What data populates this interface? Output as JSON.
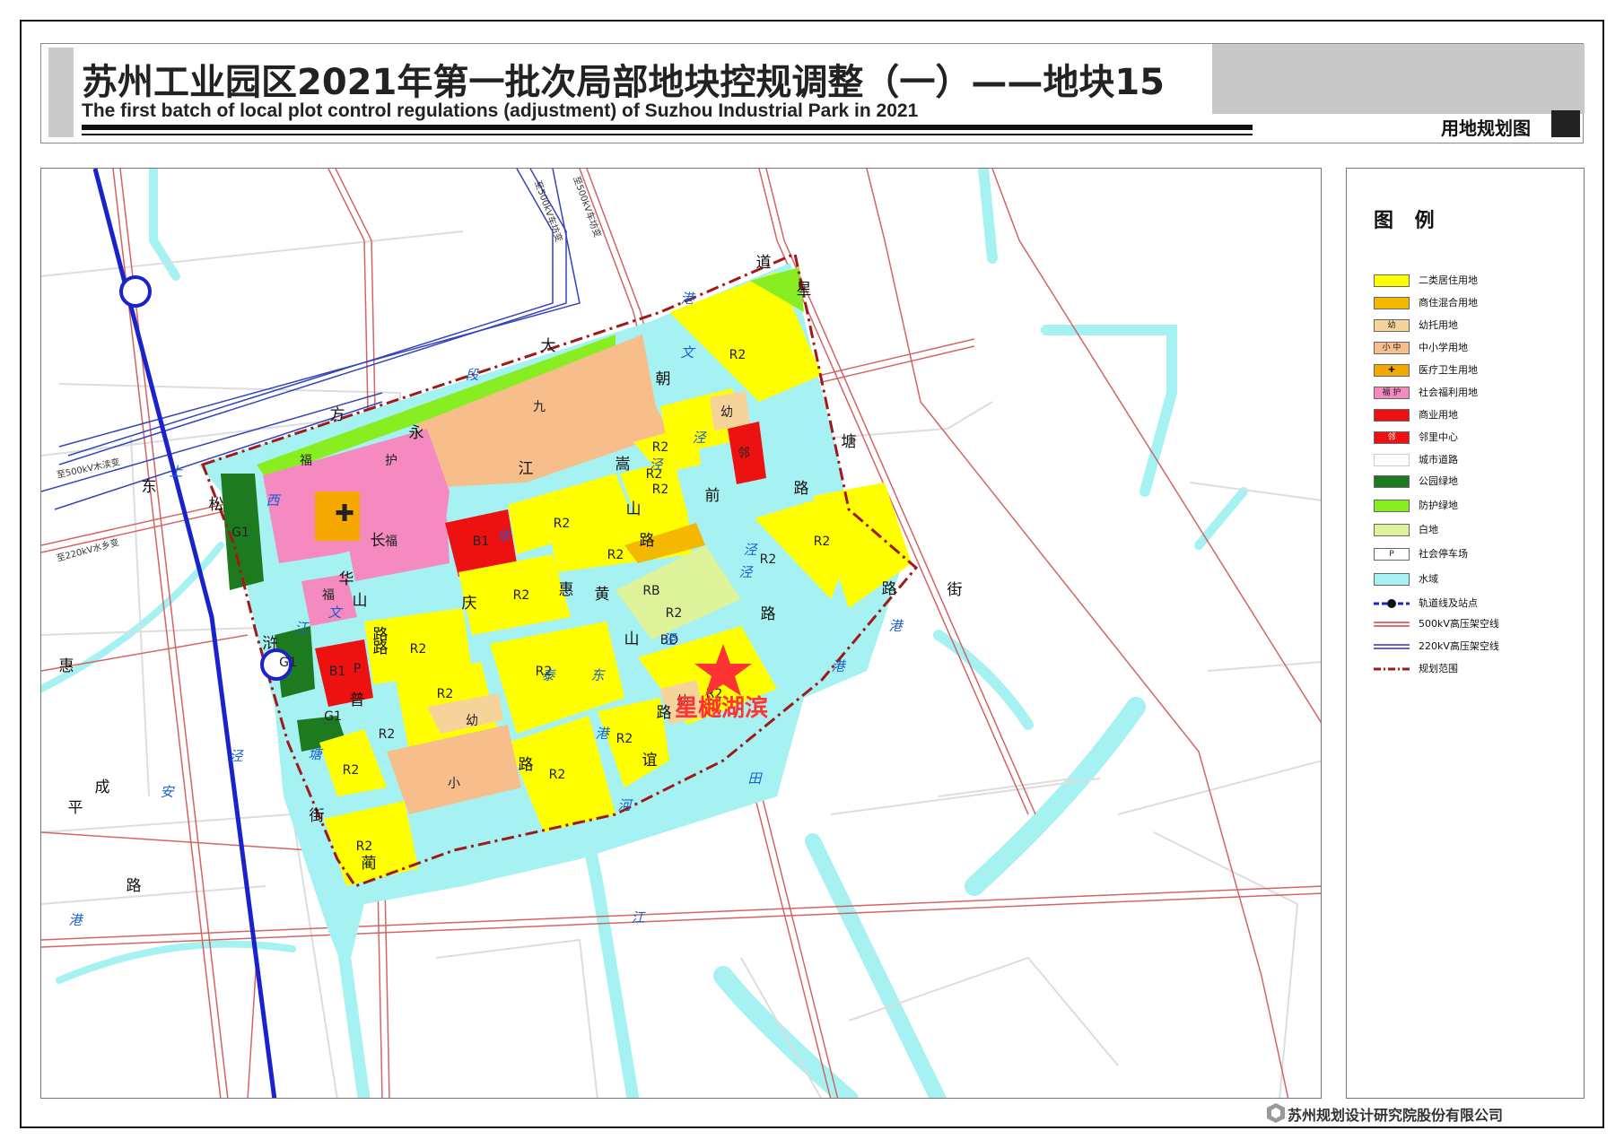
{
  "header": {
    "title_cn": "苏州工业园区2021年第一批次局部地块控规调整（一）——地块15",
    "title_en": "The first batch of local plot control regulations (adjustment) of Suzhou Industrial Park in 2021",
    "map_type": "用地规划图"
  },
  "legend": {
    "title": "图 例",
    "items": [
      {
        "label": "二类居住用地",
        "color": "#ffff00",
        "tag": ""
      },
      {
        "label": "商住混合用地",
        "color": "#f5b800",
        "tag": ""
      },
      {
        "label": "幼托用地",
        "color": "#f5d39a",
        "tag": "幼"
      },
      {
        "label": "中小学用地",
        "color": "#f7be8c",
        "tag": "小 中"
      },
      {
        "label": "医疗卫生用地",
        "color": "#f5a800",
        "tag": "✚"
      },
      {
        "label": "社会福利用地",
        "color": "#f48ac0",
        "tag": "福 护"
      },
      {
        "label": "商业用地",
        "color": "#ee1111",
        "tag": ""
      },
      {
        "label": "邻里中心",
        "color": "#ee1111",
        "tag": "邻"
      },
      {
        "label": "城市道路",
        "color": "#ffffff",
        "tag": ""
      },
      {
        "label": "公园绿地",
        "color": "#1e7a1e",
        "tag": ""
      },
      {
        "label": "防护绿地",
        "color": "#88ee22",
        "tag": ""
      },
      {
        "label": "白地",
        "color": "#def29a",
        "tag": ""
      },
      {
        "label": "社会停车场",
        "color": "#ffffff",
        "tag": "P"
      },
      {
        "label": "水域",
        "color": "#a6f2f2",
        "tag": ""
      },
      {
        "label": "轨道线及站点",
        "color": "#1a22cc",
        "tag": ""
      },
      {
        "label": "500kV高压架空线",
        "color": "#d44444",
        "tag": ""
      },
      {
        "label": "220kV高压架空线",
        "color": "#333399",
        "tag": ""
      },
      {
        "label": "规划范围",
        "color": "#a01818",
        "tag": ""
      }
    ]
  },
  "map": {
    "parcel_labels": [
      "R2",
      "R2",
      "R2",
      "R2",
      "R2",
      "R2",
      "R2",
      "R2",
      "R2",
      "R2",
      "R2",
      "R2",
      "R2",
      "R2",
      "R2",
      "R2",
      "R2",
      "R2",
      "R2",
      "B1",
      "B1",
      "P",
      "RB",
      "BD",
      "G1",
      "G1",
      "G1",
      "幼",
      "幼",
      "幼",
      "小",
      "九",
      "福",
      "护",
      "福",
      "福",
      "邻",
      "✚"
    ],
    "road_names": {
      "dafang": [
        "大",
        "方"
      ],
      "dongsong": [
        "东",
        "松"
      ],
      "yongjiang": [
        "永",
        "江"
      ],
      "changhua": [
        "长",
        "华"
      ],
      "huaqing": [
        "华",
        "山",
        "路"
      ],
      "qingqing": [
        "庆"
      ],
      "huihuang": [
        "惠",
        "黄"
      ],
      "songshan": [
        "嵩",
        "山",
        "路"
      ],
      "chaoqian": [
        "朝",
        "前"
      ],
      "xingtang": [
        "星",
        "塘",
        "路"
      ],
      "daoroad": [
        "道"
      ],
      "jie_right": [
        "街"
      ],
      "putuo": [
        "普",
        "路"
      ],
      "hutang": [
        "浒",
        "惠"
      ],
      "pingcheng": [
        "平",
        "成",
        "路"
      ],
      "jie_left": [
        "街",
        "蔺"
      ],
      "yishan": [
        "山",
        "路"
      ],
      "donglu": [
        "路",
        "谊"
      ],
      "rright": [
        "路",
        "路"
      ]
    },
    "water_names": [
      "西",
      "文",
      "江",
      "塘",
      "港",
      "文",
      "泾",
      "泾",
      "泾",
      "安",
      "泾",
      "港",
      "段",
      "上",
      "港",
      "泾",
      "港",
      "泾",
      "河",
      "田",
      "江",
      "泰",
      "东",
      "港",
      "华"
    ],
    "transmission_labels": [
      "至500kV车坊变",
      "至500kV车坊变",
      "至500kV木渎变",
      "至220kV水乡变"
    ],
    "highlight_label": "星樾湖滨",
    "highlight_color": "#ff3333"
  },
  "footer": {
    "company": "苏州规划设计研究院股份有限公司"
  }
}
